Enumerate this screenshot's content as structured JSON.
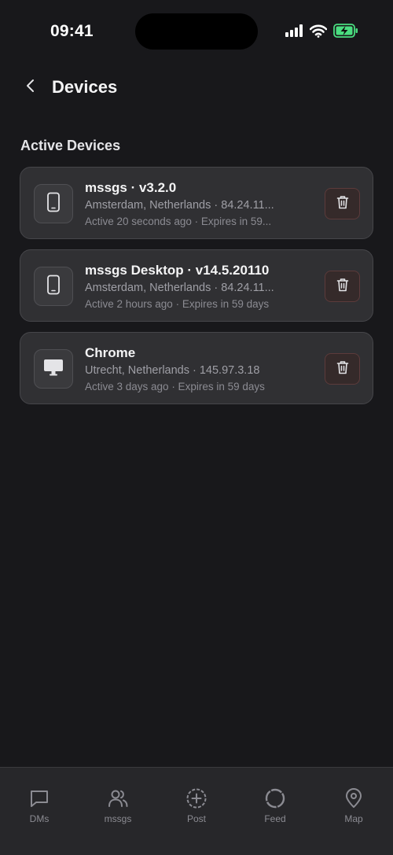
{
  "status_bar": {
    "time": "09:41"
  },
  "header": {
    "title": "Devices"
  },
  "section": {
    "title": "Active Devices"
  },
  "devices": [
    {
      "icon": "smartphone-icon",
      "name": "mssgs · v3.2.0",
      "location": "Amsterdam, Netherlands · 84.24.11...",
      "activity": "Active 20 seconds ago · Expires in 59..."
    },
    {
      "icon": "smartphone-icon",
      "name": "mssgs Desktop · v14.5.20110",
      "location": "Amsterdam, Netherlands · 84.24.11...",
      "activity": "Active 2 hours ago · Expires in 59 days"
    },
    {
      "icon": "monitor-icon",
      "name": "Chrome",
      "location": "Utrecht, Netherlands · 145.97.3.18",
      "activity": "Active 3 days ago · Expires in 59 days"
    }
  ],
  "tab_bar": {
    "tabs": [
      {
        "label": "DMs",
        "icon": "message-square-icon"
      },
      {
        "label": "mssgs",
        "icon": "users-icon"
      },
      {
        "label": "Post",
        "icon": "plus-circle-icon"
      },
      {
        "label": "Feed",
        "icon": "circle-icon"
      },
      {
        "label": "Map",
        "icon": "map-pin-icon"
      }
    ]
  },
  "colors": {
    "background": "#18181b",
    "card": "#303033",
    "danger": "#5c3b3b",
    "battery": "#4ade80"
  }
}
